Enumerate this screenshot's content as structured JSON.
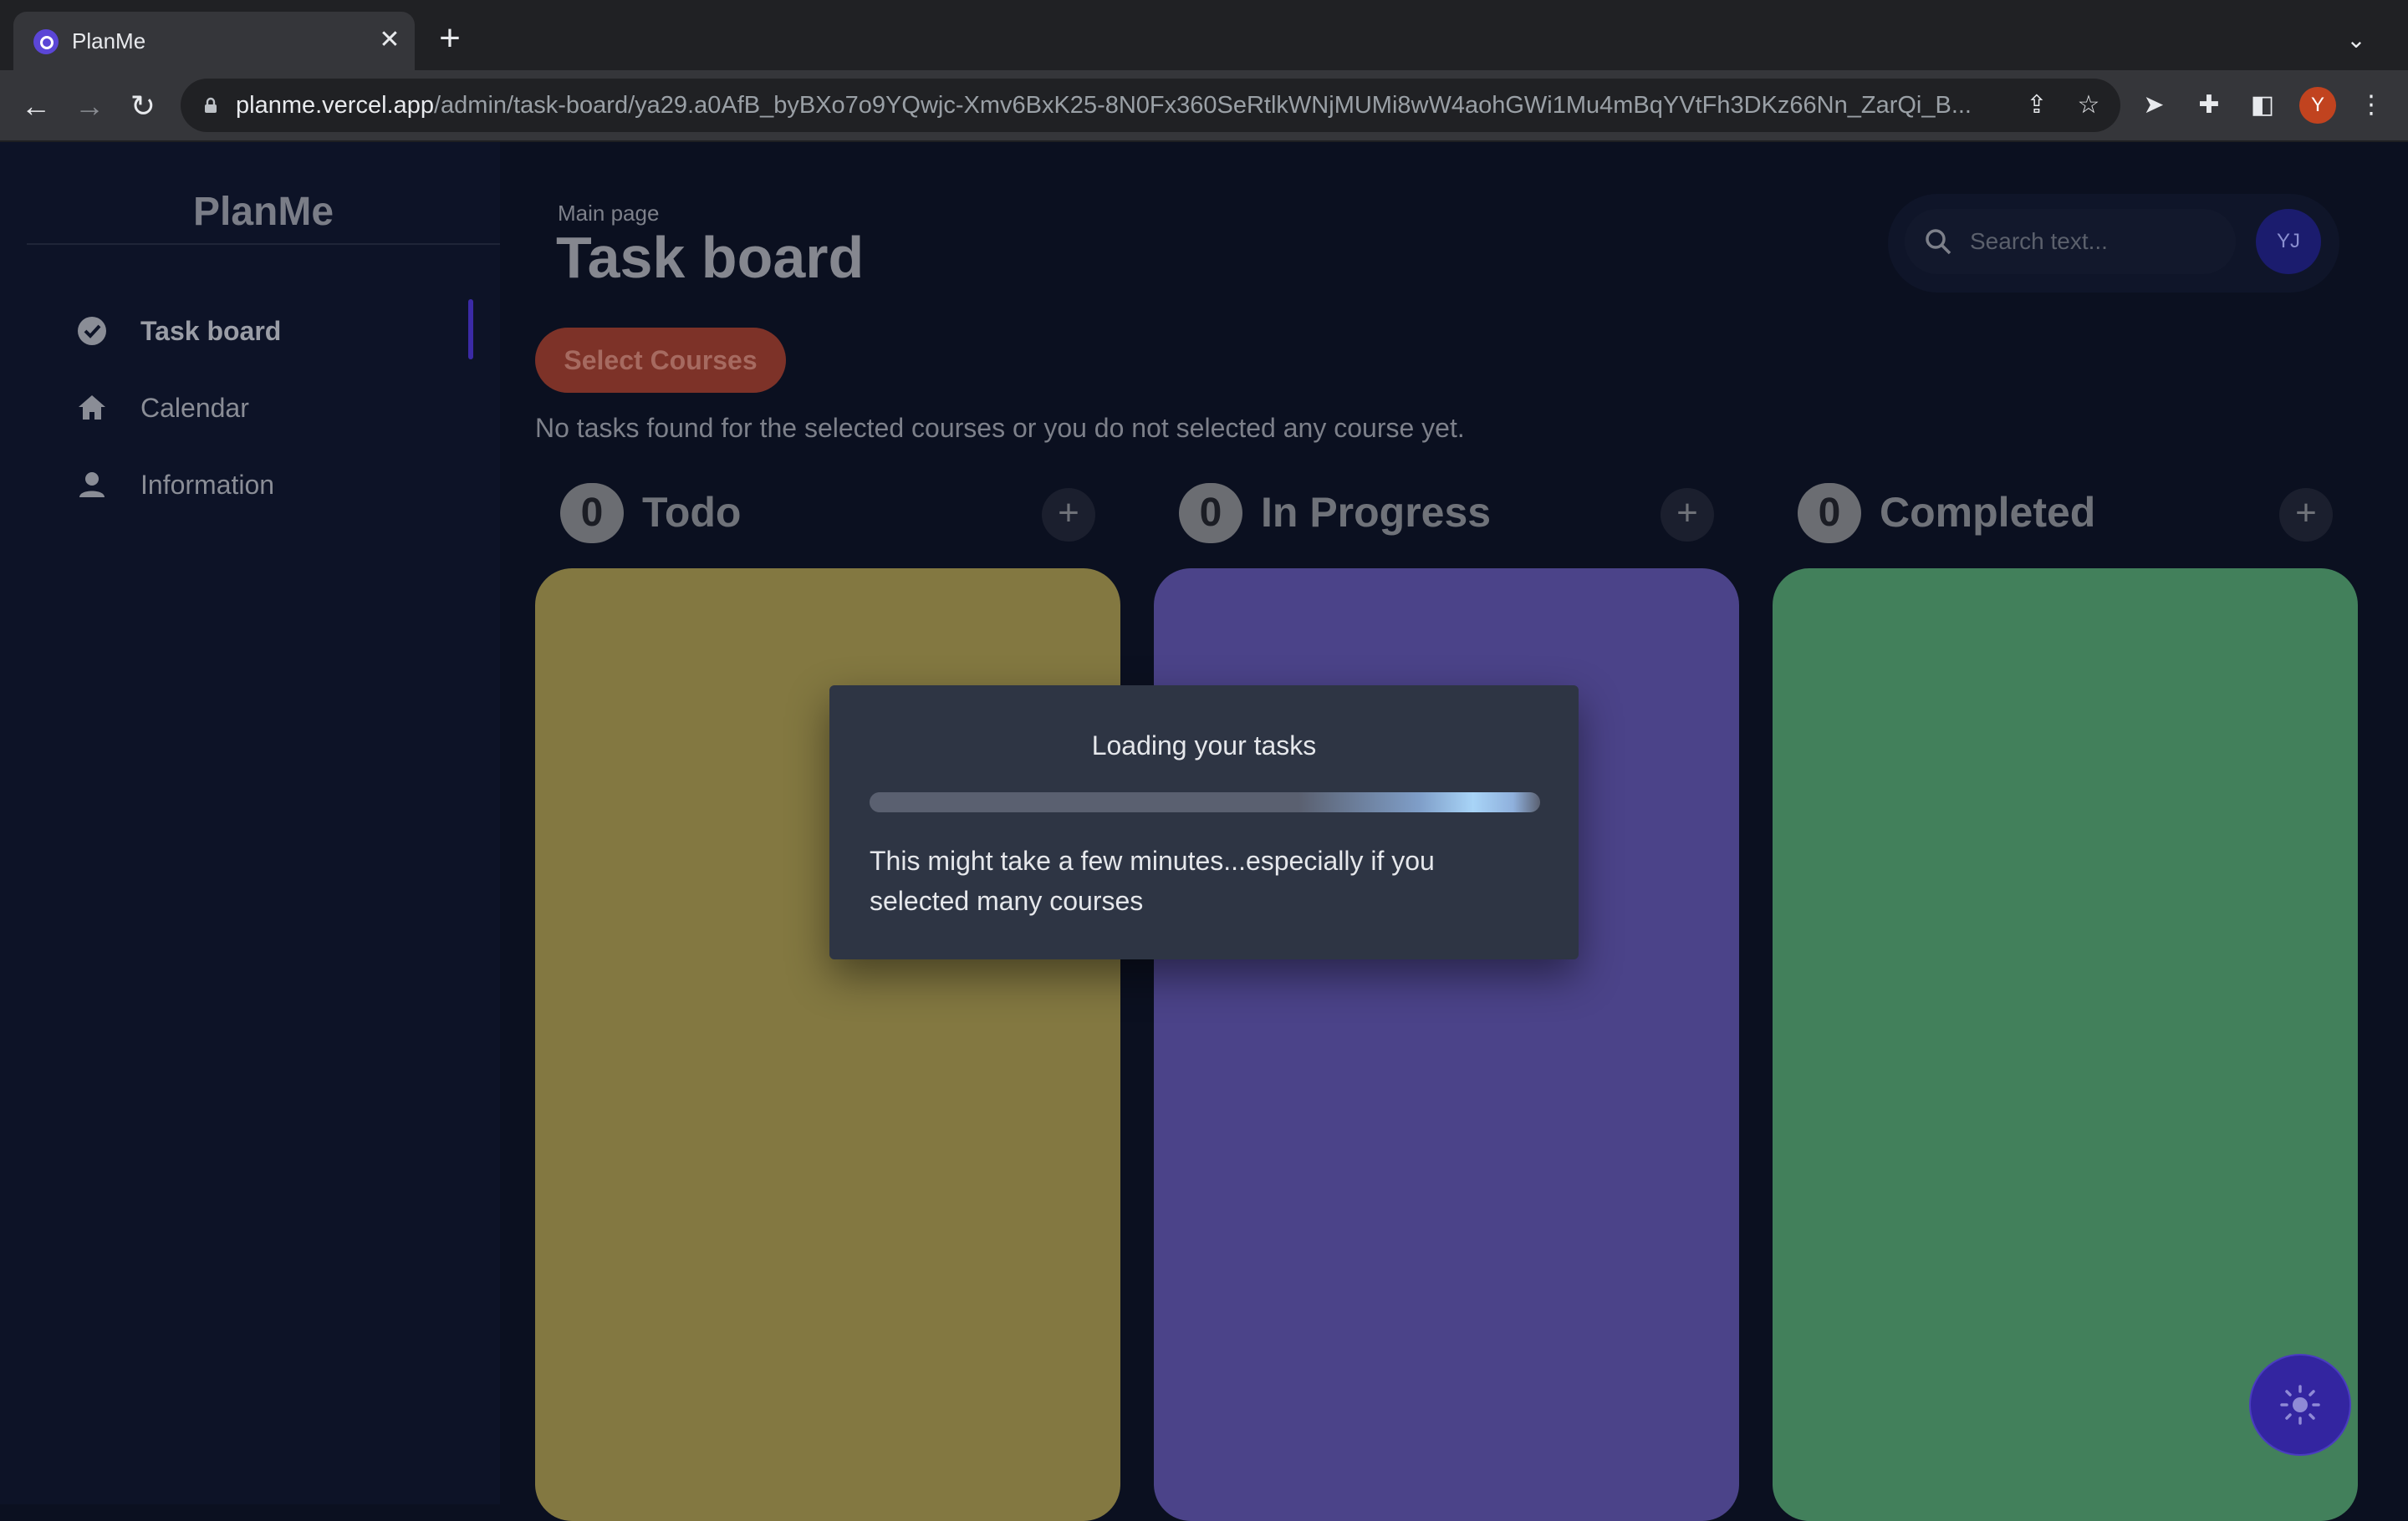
{
  "browser": {
    "tab_title": "PlanMe",
    "url_host": "planme.vercel.app",
    "url_path": "/admin/task-board/ya29.a0AfB_byBXo7o9YQwjc-Xmv6BxK25-8N0Fx360SeRtlkWNjMUMi8wW4aohGWi1Mu4mBqYVtFh3DKz66Nn_ZarQi_B...",
    "profile_initial": "Y"
  },
  "sidebar": {
    "brand": "PlanMe",
    "items": [
      {
        "label": "Task board",
        "icon": "check-circle-icon",
        "active": true
      },
      {
        "label": "Calendar",
        "icon": "home-icon",
        "active": false
      },
      {
        "label": "Information",
        "icon": "person-icon",
        "active": false
      }
    ]
  },
  "header": {
    "breadcrumb": "Main page",
    "title": "Task board",
    "search_placeholder": "Search text...",
    "avatar_initials": "YJ"
  },
  "main": {
    "select_courses_label": "Select Courses",
    "empty_message": "No tasks found for the selected courses or you do not selected any course yet.",
    "columns": [
      {
        "count": "0",
        "title": "Todo",
        "color": "#837841"
      },
      {
        "count": "0",
        "title": "In Progress",
        "color": "#4b4389"
      },
      {
        "count": "0",
        "title": "Completed",
        "color": "#42805b"
      }
    ]
  },
  "dialog": {
    "title": "Loading your tasks",
    "message": "This might take a few minutes...especially if you selected many courses",
    "progress_percent": 100
  },
  "theme_toggle": {
    "icon": "sun-icon"
  }
}
